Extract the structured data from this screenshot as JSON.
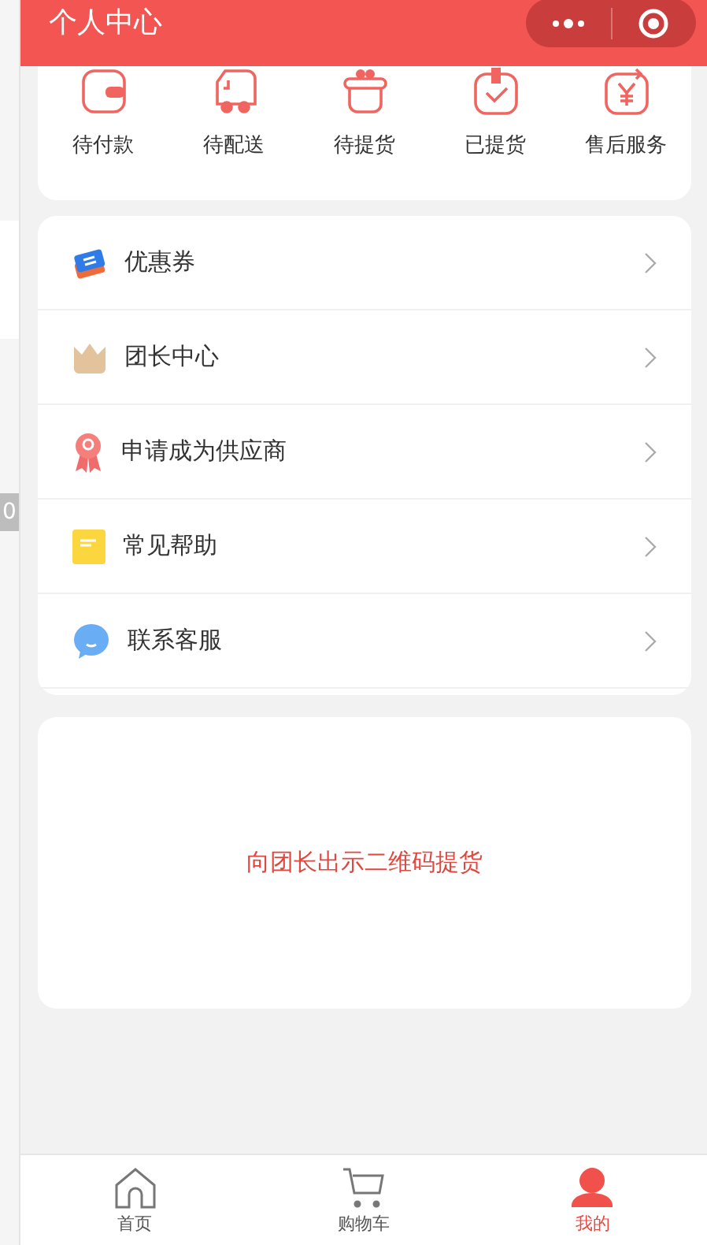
{
  "header": {
    "title": "个人中心"
  },
  "behind_page": {
    "badge": "0"
  },
  "orders": [
    {
      "label": "待付款",
      "kind": "wallet"
    },
    {
      "label": "待配送",
      "kind": "truck"
    },
    {
      "label": "待提货",
      "kind": "gift"
    },
    {
      "label": "已提货",
      "kind": "check"
    },
    {
      "label": "售后服务",
      "kind": "refund"
    }
  ],
  "menu": [
    {
      "label": "优惠券",
      "kind": "coupon"
    },
    {
      "label": "团长中心",
      "kind": "crown"
    },
    {
      "label": "申请成为供应商",
      "kind": "ribbon"
    },
    {
      "label": "常见帮助",
      "kind": "note"
    },
    {
      "label": "联系客服",
      "kind": "chat"
    }
  ],
  "qr_card": {
    "text": "向团长出示二维码提货"
  },
  "tabs": [
    {
      "label": "首页",
      "kind": "home",
      "selected": false
    },
    {
      "label": "购物车",
      "kind": "cart",
      "selected": false
    },
    {
      "label": "我的",
      "kind": "user",
      "selected": true
    }
  ]
}
